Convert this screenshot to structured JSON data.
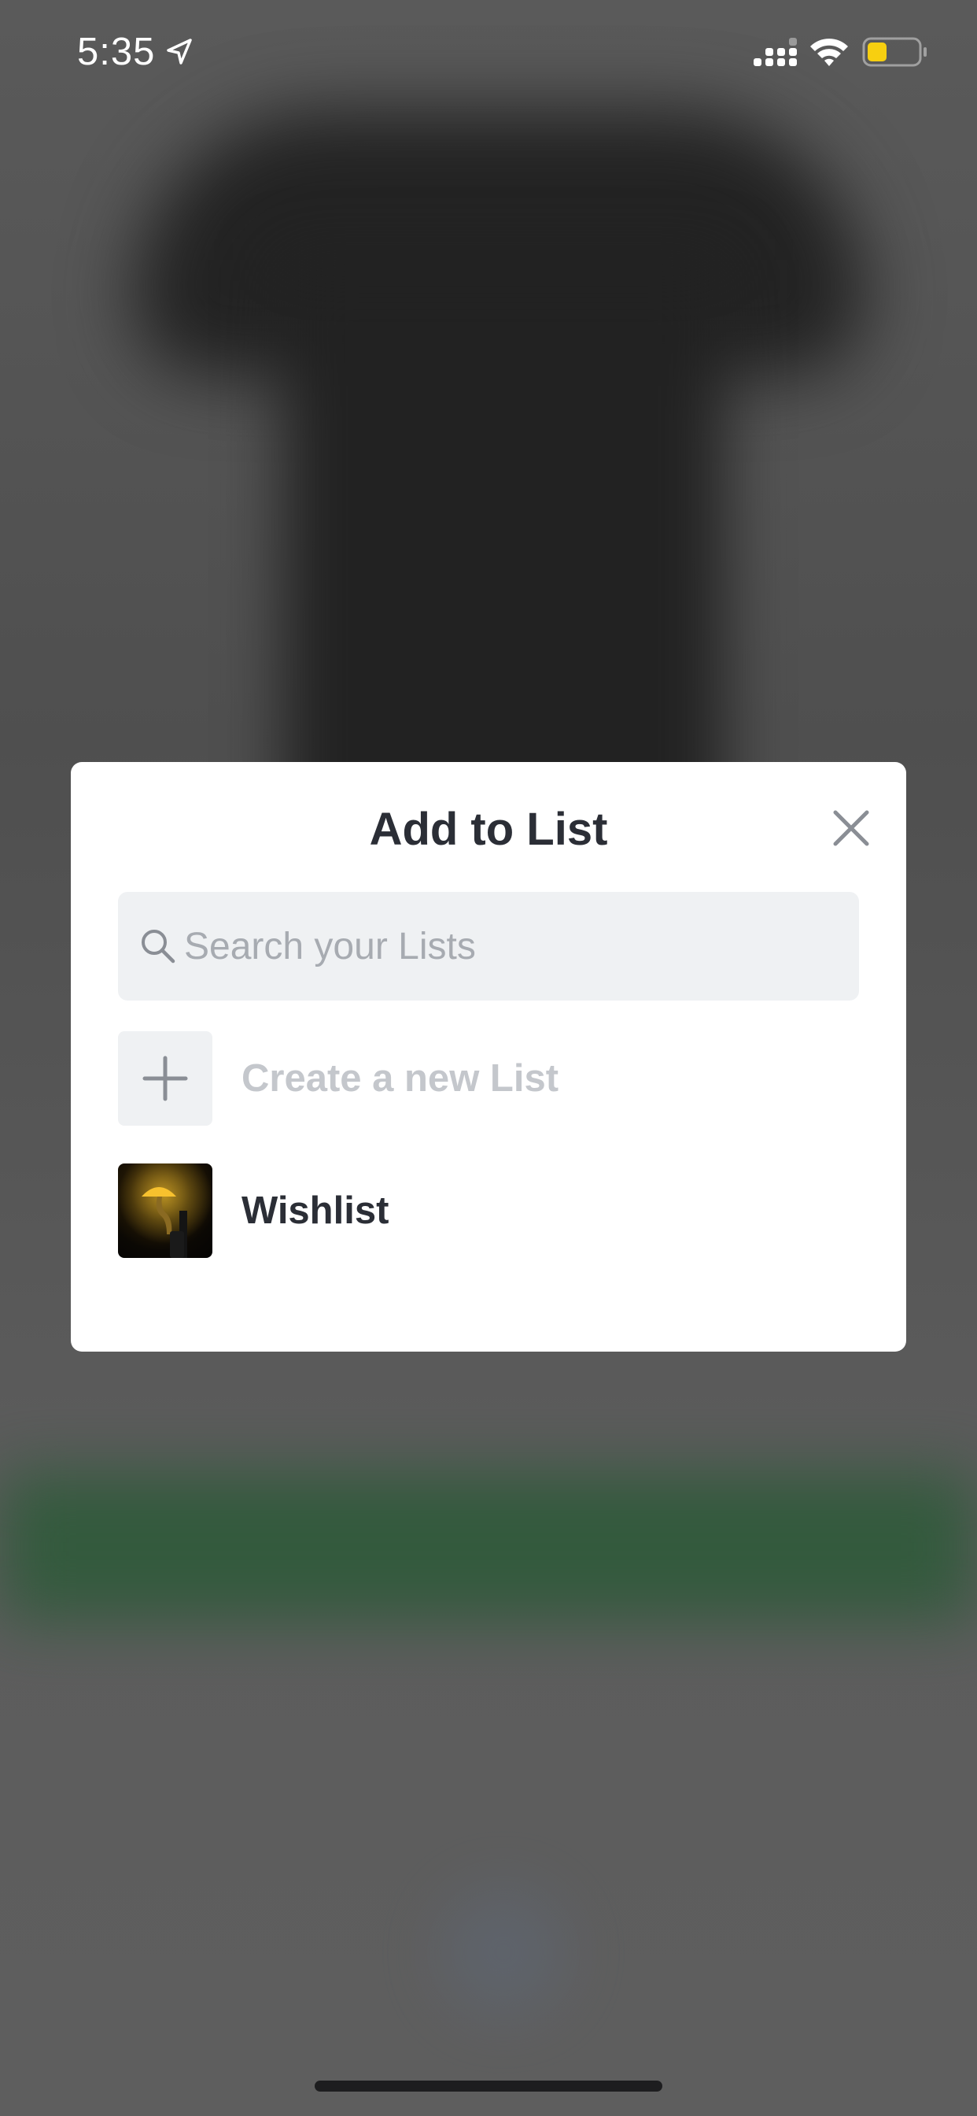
{
  "status_bar": {
    "time": "5:35",
    "battery_color": "#f7cf10"
  },
  "modal": {
    "title": "Add to List",
    "close_icon": "close-icon",
    "search": {
      "placeholder": "Search your Lists",
      "value": ""
    },
    "create_label": "Create a new List",
    "lists": [
      {
        "name": "Wishlist",
        "thumbnail": "mushroom-lamp-thumbnail"
      }
    ]
  },
  "colors": {
    "title_text": "#2b2e36",
    "muted_text": "#c4c7cc",
    "search_bg": "#eff1f3",
    "modal_bg": "#ffffff"
  }
}
